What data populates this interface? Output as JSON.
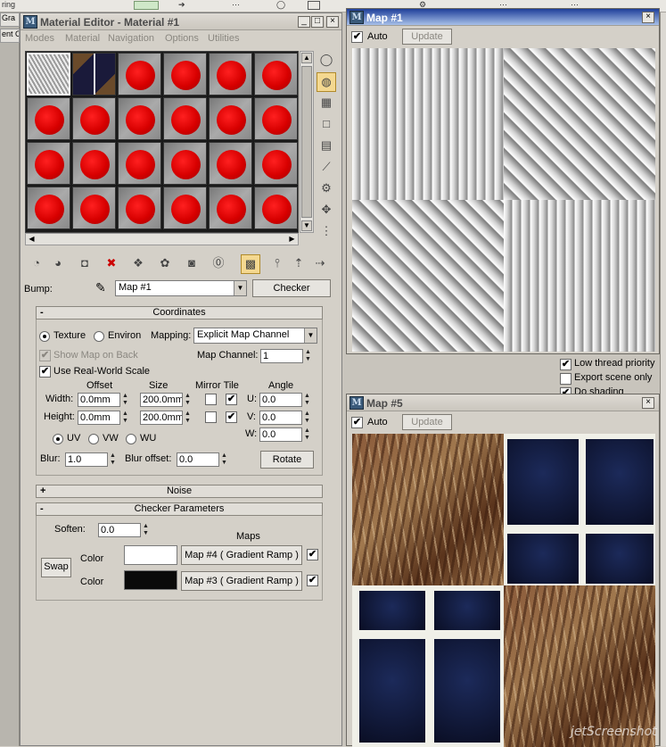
{
  "top_strip": {
    "left_text": "ring"
  },
  "left_tabs": [
    "Gra",
    "ent O"
  ],
  "material_editor": {
    "title": "Material Editor - Material #1",
    "menu": [
      "Modes",
      "Material",
      "Navigation",
      "Options",
      "Utilities"
    ],
    "bump": {
      "label": "Bump:",
      "map_name": "Map #1",
      "type_button": "Checker"
    },
    "coordinates": {
      "header": "Coordinates",
      "texture_label": "Texture",
      "environ_label": "Environ",
      "mapping_label": "Mapping:",
      "mapping_value": "Explicit Map Channel",
      "show_map_on_back": "Show Map on Back",
      "map_channel_label": "Map Channel:",
      "map_channel_value": "1",
      "use_real_world_scale": "Use Real-World Scale",
      "offset_header": "Offset",
      "size_header": "Size",
      "mirror_tile_header": "Mirror Tile",
      "angle_header": "Angle",
      "width_label": "Width:",
      "width_offset": "0.0mm",
      "width_size": "200.0mm",
      "height_label": "Height:",
      "height_offset": "0.0mm",
      "height_size": "200.0mm",
      "u_label": "U:",
      "u_value": "0.0",
      "v_label": "V:",
      "v_value": "0.0",
      "w_label": "W:",
      "w_value": "0.0",
      "uv": "UV",
      "vw": "VW",
      "wu": "WU",
      "blur_label": "Blur:",
      "blur_value": "1.0",
      "blur_offset_label": "Blur offset:",
      "blur_offset_value": "0.0",
      "rotate_button": "Rotate"
    },
    "noise": {
      "header": "Noise"
    },
    "checker": {
      "header": "Checker Parameters",
      "soften_label": "Soften:",
      "soften_value": "0.0",
      "maps_label": "Maps",
      "swap_button": "Swap",
      "color_label": "Color",
      "color1": "#ffffff",
      "color2": "#0a0a0a",
      "map1": "Map #4  ( Gradient Ramp )",
      "map2": "Map #3  ( Gradient Ramp )"
    }
  },
  "map1_window": {
    "title": "Map #1",
    "auto_label": "Auto",
    "update_button": "Update"
  },
  "map5_window": {
    "title": "Map #5",
    "auto_label": "Auto",
    "update_button": "Update"
  },
  "background_panel": {
    "low_thread_priority": "Low thread priority",
    "export_scene_only": "Export scene only",
    "do_shading": "Do shading"
  },
  "watermark": "jetScreenshot"
}
